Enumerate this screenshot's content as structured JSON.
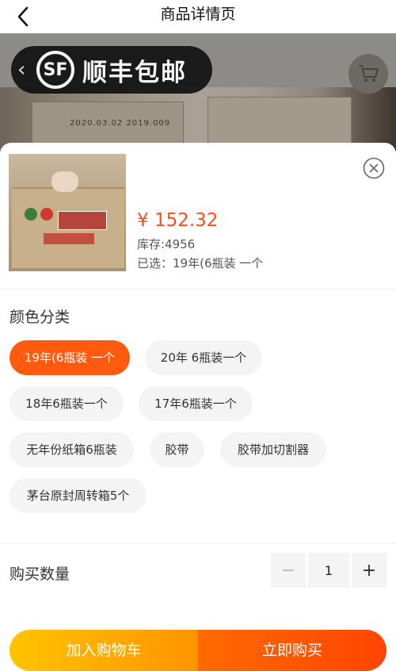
{
  "navbar": {
    "title": "商品详情页"
  },
  "background": {
    "banner_text": "顺丰包邮",
    "logo_text": "SF",
    "box_text": "2020.03.02 2019.009"
  },
  "product": {
    "price": "¥ 152.32",
    "stock": "库存:4956",
    "selected": "已选：19年(6瓶装 一个"
  },
  "options": {
    "title": "颜色分类",
    "items": [
      {
        "label": "19年(6瓶装 一个",
        "active": true
      },
      {
        "label": "20年 6瓶装一个",
        "active": false
      },
      {
        "label": "18年6瓶装一个",
        "active": false
      },
      {
        "label": "17年6瓶装一个",
        "active": false
      },
      {
        "label": "无年份纸箱6瓶装",
        "active": false
      },
      {
        "label": "胶带",
        "active": false
      },
      {
        "label": "胶带加切割器",
        "active": false
      },
      {
        "label": "茅台原封周转箱5个",
        "active": false
      }
    ]
  },
  "quantity": {
    "label": "购买数量",
    "value": "1",
    "minus": "−",
    "plus": "+"
  },
  "actions": {
    "add_to_cart": "加入购物车",
    "buy_now": "立即购买"
  },
  "colors": {
    "accent": "#ff5a0f",
    "price": "#ff4b1f",
    "cart_start": "#ffc300",
    "cart_end": "#ff9400",
    "buy_start": "#ff6a00",
    "buy_end": "#ff4500"
  },
  "icons": {
    "back": "chevron-left-icon",
    "cart": "cart-icon",
    "close": "close-circle-icon"
  }
}
